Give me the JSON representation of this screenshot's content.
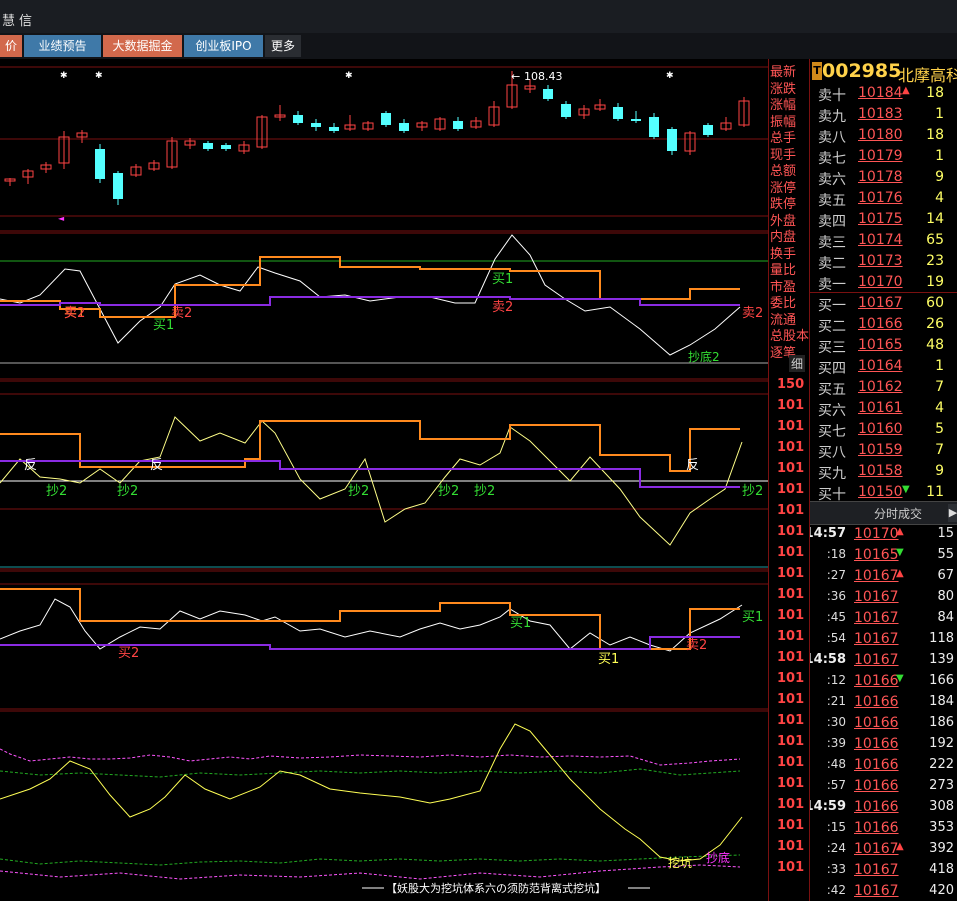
{
  "titlebar": {
    "text1": "慧",
    "text2": "信"
  },
  "tabs": [
    {
      "label": "价",
      "color": "#d2694c"
    },
    {
      "label": "业绩预告",
      "color": "#3f79a8"
    },
    {
      "label": "大数据掘金",
      "color": "#d2694c"
    },
    {
      "label": "创业板IPO",
      "color": "#3f79a8"
    },
    {
      "label": "更多",
      "color": "#2a2d32"
    }
  ],
  "stock": {
    "code": "002985",
    "name": "北摩高科",
    "badge": "T"
  },
  "chart": {
    "high_label": "108.43",
    "signals": {
      "buy1": "买1",
      "buy2": "买2",
      "sell2": "卖2",
      "chao2": "抄2",
      "chaodi2": "抄底2",
      "fan": "反",
      "wakeng": "挖坑",
      "chaodi": "抄底"
    },
    "bottom_caption": "【妖股大为挖坑体系六の须防范背离式挖坑】"
  },
  "axis": {
    "side_labels": [
      "最新",
      "涨跌",
      "涨幅",
      "振幅",
      "总手",
      "现手",
      "总额",
      "涨停",
      "跌停",
      "外盘",
      "内盘",
      "换手",
      "量比",
      "市盈",
      "委比",
      "流通",
      "总股本",
      "逐笔"
    ],
    "detail_button": "细",
    "values": [
      "150",
      "101",
      "101",
      "101",
      "101",
      "101",
      "101",
      "101",
      "101",
      "101",
      "101",
      "101",
      "101",
      "101",
      "101",
      "101",
      "101",
      "101",
      "101",
      "101",
      "101",
      "101",
      "101",
      "101"
    ]
  },
  "sell_orders": [
    {
      "label": "卖十",
      "price": "10184",
      "arrow": "up",
      "vol": "18"
    },
    {
      "label": "卖九",
      "price": "10183",
      "arrow": "",
      "vol": "1"
    },
    {
      "label": "卖八",
      "price": "10180",
      "arrow": "",
      "vol": "18"
    },
    {
      "label": "卖七",
      "price": "10179",
      "arrow": "",
      "vol": "1"
    },
    {
      "label": "卖六",
      "price": "10178",
      "arrow": "",
      "vol": "9"
    },
    {
      "label": "卖五",
      "price": "10176",
      "arrow": "",
      "vol": "4"
    },
    {
      "label": "卖四",
      "price": "10175",
      "arrow": "",
      "vol": "14"
    },
    {
      "label": "卖三",
      "price": "10174",
      "arrow": "",
      "vol": "65"
    },
    {
      "label": "卖二",
      "price": "10173",
      "arrow": "",
      "vol": "23"
    },
    {
      "label": "卖一",
      "price": "10170",
      "arrow": "",
      "vol": "19"
    }
  ],
  "buy_orders": [
    {
      "label": "买一",
      "price": "10167",
      "arrow": "",
      "vol": "60"
    },
    {
      "label": "买二",
      "price": "10166",
      "arrow": "",
      "vol": "26"
    },
    {
      "label": "买三",
      "price": "10165",
      "arrow": "",
      "vol": "48"
    },
    {
      "label": "买四",
      "price": "10164",
      "arrow": "",
      "vol": "1"
    },
    {
      "label": "买五",
      "price": "10162",
      "arrow": "",
      "vol": "7"
    },
    {
      "label": "买六",
      "price": "10161",
      "arrow": "",
      "vol": "4"
    },
    {
      "label": "买七",
      "price": "10160",
      "arrow": "",
      "vol": "5"
    },
    {
      "label": "买八",
      "price": "10159",
      "arrow": "",
      "vol": "7"
    },
    {
      "label": "买九",
      "price": "10158",
      "arrow": "",
      "vol": "9"
    },
    {
      "label": "买十",
      "price": "10150",
      "arrow": "down",
      "vol": "11"
    }
  ],
  "ticks_header": "分时成交",
  "ticks": [
    {
      "time": "14:57",
      "full": true,
      "price": "10170",
      "arrow": "up",
      "vol": "15"
    },
    {
      "time": ":18",
      "full": false,
      "price": "10165",
      "arrow": "down",
      "vol": "55"
    },
    {
      "time": ":27",
      "full": false,
      "price": "10167",
      "arrow": "up",
      "vol": "67"
    },
    {
      "time": ":36",
      "full": false,
      "price": "10167",
      "arrow": "",
      "vol": "80"
    },
    {
      "time": ":45",
      "full": false,
      "price": "10167",
      "arrow": "",
      "vol": "84"
    },
    {
      "time": ":54",
      "full": false,
      "price": "10167",
      "arrow": "",
      "vol": "118"
    },
    {
      "time": "14:58",
      "full": true,
      "price": "10167",
      "arrow": "",
      "vol": "139"
    },
    {
      "time": ":12",
      "full": false,
      "price": "10166",
      "arrow": "down",
      "vol": "166"
    },
    {
      "time": ":21",
      "full": false,
      "price": "10166",
      "arrow": "",
      "vol": "184"
    },
    {
      "time": ":30",
      "full": false,
      "price": "10166",
      "arrow": "",
      "vol": "186"
    },
    {
      "time": ":39",
      "full": false,
      "price": "10166",
      "arrow": "",
      "vol": "192"
    },
    {
      "time": ":48",
      "full": false,
      "price": "10166",
      "arrow": "",
      "vol": "222"
    },
    {
      "time": ":57",
      "full": false,
      "price": "10166",
      "arrow": "",
      "vol": "273"
    },
    {
      "time": "14:59",
      "full": true,
      "price": "10166",
      "arrow": "",
      "vol": "308"
    },
    {
      "time": ":15",
      "full": false,
      "price": "10166",
      "arrow": "",
      "vol": "353"
    },
    {
      "time": ":24",
      "full": false,
      "price": "10167",
      "arrow": "up",
      "vol": "392"
    },
    {
      "time": ":33",
      "full": false,
      "price": "10167",
      "arrow": "",
      "vol": "418"
    },
    {
      "time": ":42",
      "full": false,
      "price": "10167",
      "arrow": "",
      "vol": "420"
    }
  ],
  "colors": {
    "up": "#ff4444",
    "down": "#54ffff",
    "orange": "#ff8a1e",
    "purple": "#8a2be2",
    "white": "#ffffff",
    "yellow": "#ffff55",
    "green": "#33dd33",
    "magenta": "#ff33ff",
    "grid": "#7a1010"
  }
}
